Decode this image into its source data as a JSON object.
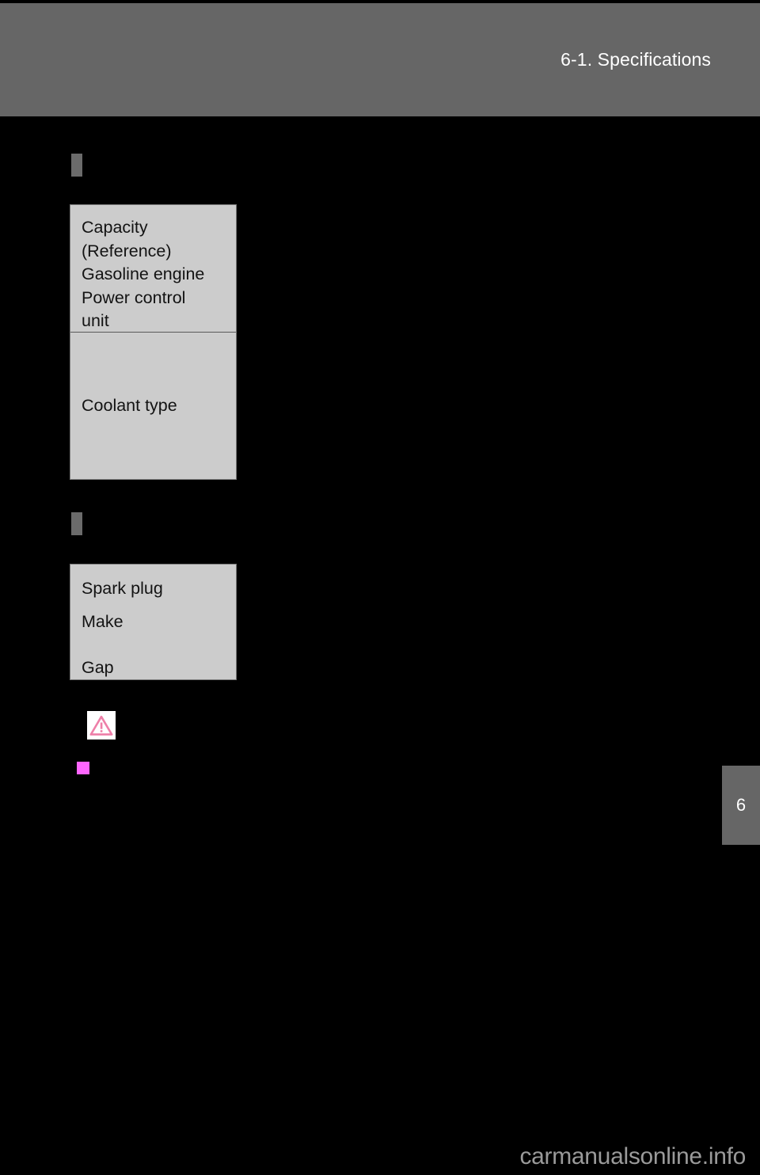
{
  "page": {
    "background_color": "#000000",
    "chapter_number": "6"
  },
  "header": {
    "title": "6-1. Specifications",
    "background_color": "#666666",
    "text_color": "#ffffff"
  },
  "sections": [
    {
      "marker_color": "#6b6b6b",
      "table": {
        "background_color": "#cccccc",
        "rows": [
          {
            "lines": [
              "Capacity",
              "(Reference)",
              "Gasoline engine",
              "Power control",
              "unit"
            ]
          },
          {
            "lines": [
              "Coolant type"
            ]
          }
        ]
      }
    },
    {
      "marker_color": "#6b6b6b",
      "table": {
        "background_color": "#cccccc",
        "rows": [
          {
            "lines": [
              "Spark plug",
              "Make",
              "Gap"
            ]
          }
        ]
      }
    }
  ],
  "notices": {
    "warning_icon_name": "warning-triangle-icon",
    "warning_icon_color": "#ee7fa8",
    "warning_icon_background": "#ffffff",
    "notice_square_color": "#ff66ff"
  },
  "chapter_tab": {
    "number": "6",
    "background_color": "#666666",
    "text_color": "#ffffff"
  },
  "watermark": {
    "text": "carmanualsonline.info",
    "color": "#9a9a9a"
  }
}
